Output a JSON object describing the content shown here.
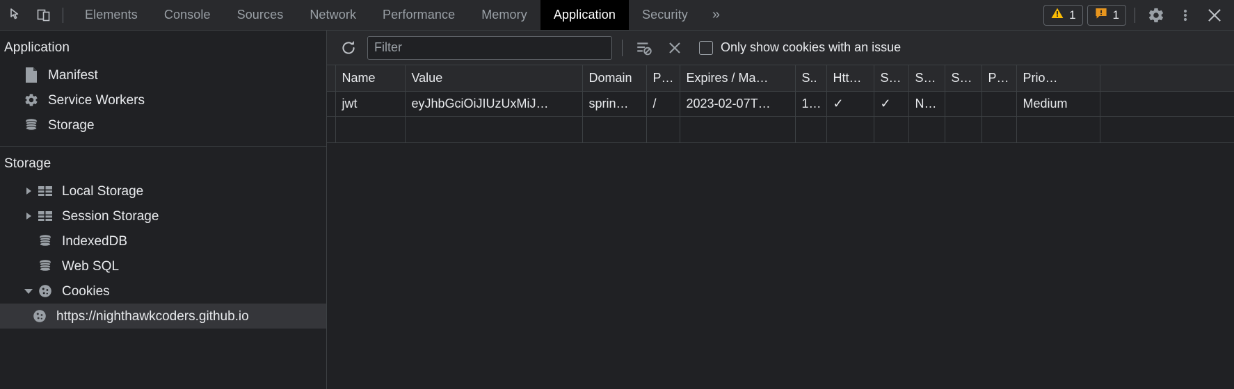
{
  "tabstrip": {
    "tools": [
      {
        "name": "inspect-element-icon",
        "label": "Inspect element"
      },
      {
        "name": "device-toolbar-icon",
        "label": "Toggle device toolbar"
      }
    ],
    "tabs": [
      {
        "label": "Elements",
        "active": false
      },
      {
        "label": "Console",
        "active": false
      },
      {
        "label": "Sources",
        "active": false
      },
      {
        "label": "Network",
        "active": false
      },
      {
        "label": "Performance",
        "active": false
      },
      {
        "label": "Memory",
        "active": false
      },
      {
        "label": "Application",
        "active": true
      },
      {
        "label": "Security",
        "active": false
      }
    ],
    "more_label": "»",
    "warnings": {
      "icon": "warning-triangle-icon",
      "count": "1",
      "color": "#fbbc04"
    },
    "issues": {
      "icon": "issue-bang-icon",
      "count": "1",
      "color": "#e8961e"
    },
    "settings_icon": "gear-icon",
    "more_menu_icon": "three-dot-menu-icon",
    "close_icon": "close-icon"
  },
  "sidebar": {
    "application": {
      "title": "Application",
      "items": [
        {
          "label": "Manifest",
          "icon": "manifest-document-icon",
          "twisty": "none"
        },
        {
          "label": "Service Workers",
          "icon": "gear-icon",
          "twisty": "none"
        },
        {
          "label": "Storage",
          "icon": "database-icon",
          "twisty": "none"
        }
      ]
    },
    "storage": {
      "title": "Storage",
      "items": [
        {
          "label": "Local Storage",
          "icon": "table-grid-icon",
          "twisty": "closed",
          "selected": false
        },
        {
          "label": "Session Storage",
          "icon": "table-grid-icon",
          "twisty": "closed",
          "selected": false
        },
        {
          "label": "IndexedDB",
          "icon": "database-icon",
          "twisty": "none",
          "selected": false
        },
        {
          "label": "Web SQL",
          "icon": "database-icon",
          "twisty": "none",
          "selected": false
        },
        {
          "label": "Cookies",
          "icon": "cookie-icon",
          "twisty": "open",
          "selected": false
        }
      ],
      "cookie_children": [
        {
          "label": "https://nighthawkcoders.github.io",
          "icon": "cookie-icon",
          "selected": true
        }
      ]
    }
  },
  "toolbar": {
    "refresh_icon": "refresh-icon",
    "filter_placeholder": "Filter",
    "filter_value": "",
    "clear_filtered_icon": "clear-filtered-cookies-icon",
    "delete_icon": "delete-cookie-icon",
    "only_issues_label": "Only show cookies with an issue",
    "only_issues_checked": false
  },
  "table": {
    "columns": [
      "Name",
      "Value",
      "Domain",
      "P…",
      "Expires / Ma…",
      "S..",
      "Htt…",
      "S…",
      "S…",
      "S…",
      "P…",
      "Prio…"
    ],
    "rows": [
      {
        "cells": [
          "jwt",
          "eyJhbGciOiJIUzUxMiJ…",
          "sprin…",
          "/",
          "2023-02-07T…",
          "1…",
          "✓",
          "✓",
          "N…",
          "",
          "",
          "Medium"
        ]
      }
    ]
  }
}
